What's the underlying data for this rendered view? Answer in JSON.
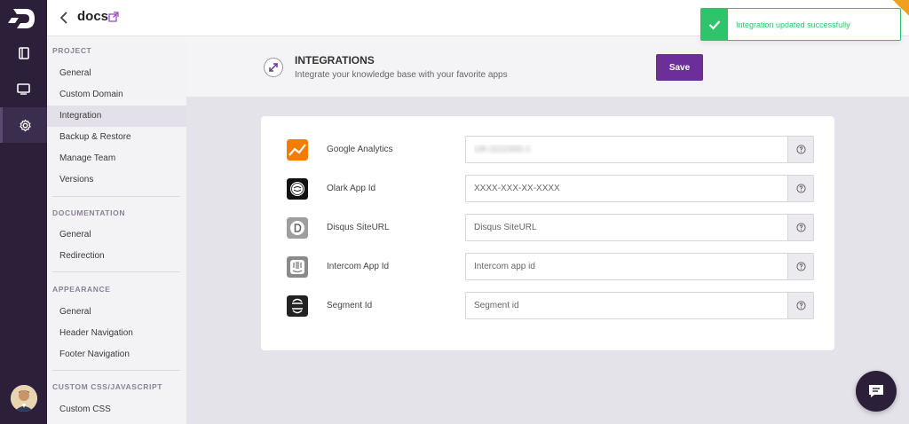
{
  "header": {
    "project_title": "docs"
  },
  "sidebar": {
    "sections": [
      {
        "heading": "PROJECT",
        "items": [
          "General",
          "Custom Domain",
          "Integration",
          "Backup & Restore",
          "Manage Team",
          "Versions"
        ]
      },
      {
        "heading": "DOCUMENTATION",
        "items": [
          "General",
          "Redirection"
        ]
      },
      {
        "heading": "APPEARANCE",
        "items": [
          "General",
          "Header Navigation",
          "Footer Navigation"
        ]
      },
      {
        "heading": "CUSTOM CSS/JAVASCRIPT",
        "items": [
          "Custom CSS"
        ]
      }
    ],
    "active_item": "Integration"
  },
  "page": {
    "title": "INTEGRATIONS",
    "subtitle": "Integrate your knowledge base with your favorite apps",
    "save_label": "Save"
  },
  "integrations": [
    {
      "label": "Google Analytics",
      "value": "UA-1112345-1",
      "placeholder": "",
      "icon": "google-analytics-icon"
    },
    {
      "label": "Olark App Id",
      "value": "",
      "placeholder": "XXXX-XXX-XX-XXXX",
      "icon": "olark-icon"
    },
    {
      "label": "Disqus SiteURL",
      "value": "",
      "placeholder": "Disqus SiteURL",
      "icon": "disqus-icon"
    },
    {
      "label": "Intercom App Id",
      "value": "",
      "placeholder": "Intercom app id",
      "icon": "intercom-icon"
    },
    {
      "label": "Segment Id",
      "value": "",
      "placeholder": "Segment id",
      "icon": "segment-icon"
    }
  ],
  "toast": {
    "message": "Integration updated successfully"
  },
  "colors": {
    "rail": "#2b1f3a",
    "accent": "#6c2f9a",
    "success": "#2ec46b"
  }
}
